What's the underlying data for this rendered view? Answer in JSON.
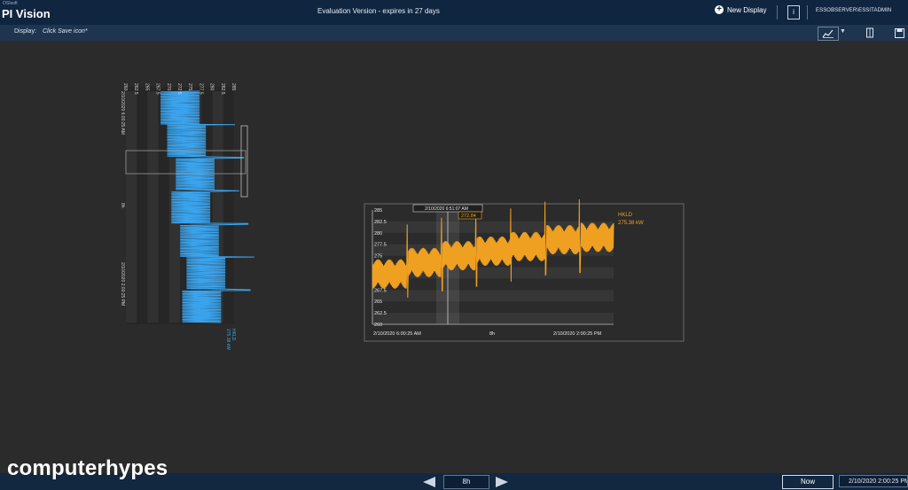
{
  "app": {
    "brand_small": "OSIsoft",
    "title": "PI Vision",
    "evaluation_text": "Evaluation Version - expires in 27 days",
    "new_display_label": "New Display",
    "info_label": "i",
    "user": "ESSOBSERVER\\ESSITADMIN"
  },
  "subbar": {
    "display_label": "Display:",
    "display_value": "Click Save icon*"
  },
  "watermark": "computerhypes",
  "timebar": {
    "duration": "8h",
    "now_label": "Now",
    "end_time": "2/10/2020 2:00:25 PM"
  },
  "colors": {
    "topbar": "#0f2540",
    "subbar": "#1e3550",
    "canvas": "#2b2b2b",
    "trend_main": "#f0a020",
    "trend_rotated": "#2f9ee6"
  },
  "icons": {
    "new_display": "plus-circle-icon",
    "trend_type": "line-chart-icon",
    "dropdown": "chevron-down-icon",
    "bookmark": "bookmark-icon",
    "save": "save-icon",
    "prev": "arrow-left-icon",
    "next": "arrow-right-icon"
  },
  "main_trend": {
    "start_label": "2/10/2020 6:00:25 AM",
    "mid_label": "8h",
    "end_label": "2/10/2020 2:00:25 PM",
    "cursor_time": "2/10/2020 6:51:07 AM",
    "cursor_value": "272.84",
    "legend_name": "HKLD",
    "legend_value": "275.38 kW"
  },
  "rotated_trend": {
    "start_label": "2/10/2020 6:00:25 AM",
    "mid_label": "8h",
    "end_label": "2/10/2020 2:00:25 PM",
    "legend_name": "HKLD",
    "legend_value": "275.38 kW"
  },
  "chart_data": {
    "type": "line",
    "ylim": [
      260,
      285
    ],
    "yticks": [
      "285",
      "282.5",
      "280",
      "277.5",
      "275",
      "272.5",
      "270",
      "267.5",
      "265",
      "262.5",
      "260"
    ],
    "grid": true,
    "legend_position": "top-right",
    "series": [
      {
        "name": "HKLD",
        "color": "#f0a020",
        "step_levels": [
          271,
          273.5,
          275,
          276,
          277,
          278.5,
          279
        ],
        "ripple": 3.2
      }
    ]
  }
}
